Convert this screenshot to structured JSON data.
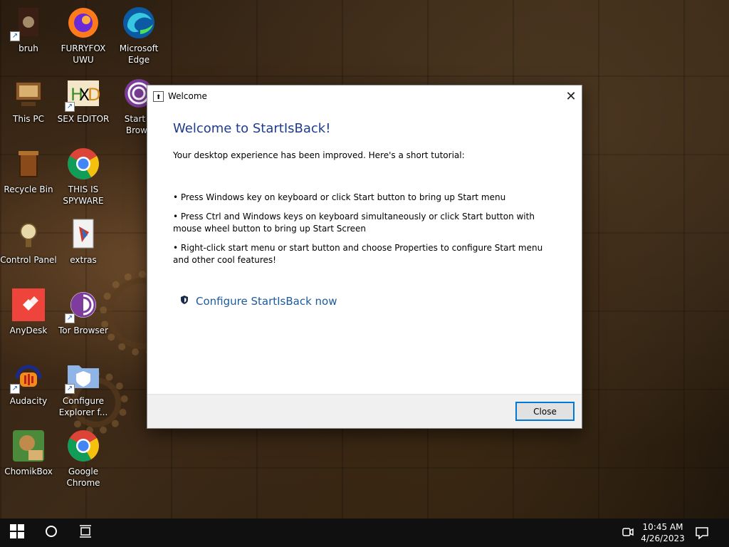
{
  "desktop": {
    "icons": [
      {
        "label": "bruh"
      },
      {
        "label": "FURRYFOX UWU"
      },
      {
        "label": "Microsoft Edge"
      },
      {
        "label": "This PC"
      },
      {
        "label": "SEX EDITOR"
      },
      {
        "label": "Start T Brows"
      },
      {
        "label": "Recycle Bin"
      },
      {
        "label": "THIS IS SPYWARE"
      },
      {
        "label": "Control Panel"
      },
      {
        "label": "extras"
      },
      {
        "label": "AnyDesk"
      },
      {
        "label": "Tor Browser"
      },
      {
        "label": "Audacity"
      },
      {
        "label": "Configure Explorer f..."
      },
      {
        "label": "ChomikBox"
      },
      {
        "label": "Google Chrome"
      }
    ]
  },
  "dialog": {
    "title": "Welcome",
    "heading": "Welcome to StartIsBack!",
    "intro": "Your desktop experience has been improved. Here's a short tutorial:",
    "bullets": [
      "• Press Windows key on keyboard or click Start button to bring up Start menu",
      "• Press Ctrl and Windows keys on keyboard simultaneously or click Start button with mouse wheel button to bring up Start Screen",
      "• Right-click start menu or start button and choose Properties to configure Start menu and other cool features!"
    ],
    "configure_link": "Configure StartIsBack now",
    "close_button": "Close"
  },
  "taskbar": {
    "time": "10:45 AM",
    "date": "4/26/2023"
  },
  "colors": {
    "heading": "#1f3c8c",
    "link": "#1c5a9c",
    "button_border": "#0078d7",
    "taskbar": "#101010"
  }
}
